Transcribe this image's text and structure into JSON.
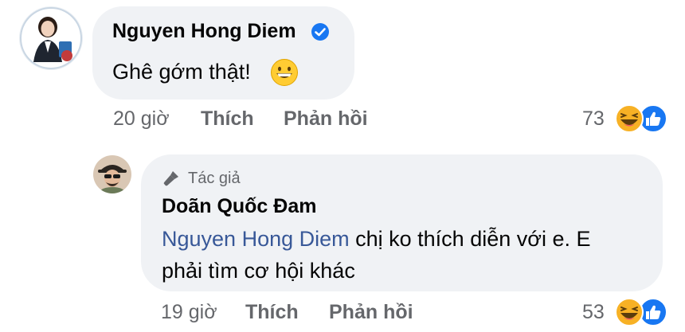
{
  "comment": {
    "author": "Nguyen Hong Diem",
    "verified_icon": "verified-check-icon",
    "text": "Ghê gớm thật!",
    "emoji": "grinning-face-emoji",
    "time": "20 giờ",
    "like_label": "Thích",
    "reply_label": "Phản hồi",
    "reaction_count": "73",
    "reactions": [
      "laugh-reaction-icon",
      "like-reaction-icon"
    ]
  },
  "reply": {
    "badge_icon": "microphone-icon",
    "badge_label": "Tác giả",
    "author": "Doãn Quốc Đam",
    "mention": "Nguyen Hong Diem",
    "text_line1": " chị ko thích diễn với e. E",
    "text_line2": "phải tìm cơ hội khác",
    "time": "19 giờ",
    "like_label": "Thích",
    "reply_label": "Phản hồi",
    "reaction_count": "53",
    "reactions": [
      "laugh-reaction-icon",
      "like-reaction-icon"
    ]
  },
  "colors": {
    "bubble_bg": "#f0f2f5",
    "mention": "#385898",
    "meta": "#65676b",
    "like_blue": "#1877f2",
    "verified_blue": "#1877f2",
    "laugh_yellow": "#f7b125"
  }
}
